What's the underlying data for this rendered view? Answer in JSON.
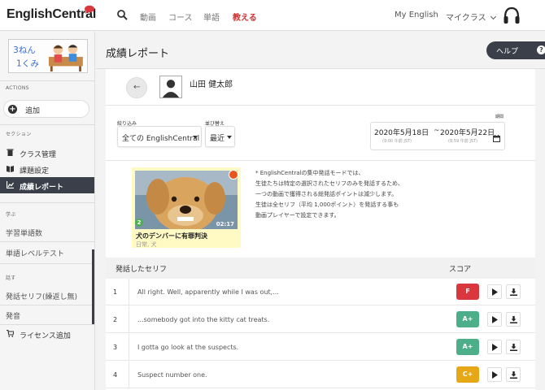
{
  "nav": {
    "logo": "EnglishCentral",
    "links": [
      "動画",
      "コース",
      "単語",
      "教える"
    ],
    "my_english": "My English",
    "my_class": "マイクラス"
  },
  "sidebar": {
    "class_image_text": "3ねん1くみ",
    "actions_label": "ACTIONS",
    "add_label": "追加",
    "section_label": "セクション",
    "items": [
      {
        "label": "クラス管理",
        "icon": "trash-icon"
      },
      {
        "label": "課題設定",
        "icon": "book-icon"
      },
      {
        "label": "成績レポート",
        "icon": "chart-icon"
      }
    ],
    "study_label": "学ぶ",
    "study_items": [
      "学習単語数",
      "単語レベルテスト"
    ],
    "speak_label": "話す",
    "speak_items": [
      "発話セリフ(繰返し無)",
      "発音"
    ],
    "license_label": "ライセンス追加"
  },
  "main": {
    "title": "成績レポート",
    "help_label": "ヘルプ",
    "user_name": "山田 健太郎",
    "filter_label": "絞り込み",
    "filter_value": "全ての EnglishCentral",
    "sort_label": "並び替え",
    "sort_value": "最近",
    "period_label": "期間",
    "date_from": "2020年5月18日",
    "date_from_time": "(9:00 午前 JST)",
    "date_sep": "~",
    "date_to": "2020年5月22日",
    "date_to_time": "(8:59 午前 JST)"
  },
  "video": {
    "title": "犬のデンバーに有罪判決",
    "subtitle": "日常, 犬",
    "badge": "2",
    "duration": "02:17"
  },
  "note": [
    "* EnglishCentralの集中発話モードでは、",
    "生徒たちは特定の選択されたセリフのみを発話するため、",
    "一つの動画で獲得される総発話ポイントは減少します。",
    "生徒は全セリフ（平均 1,000ポイント）を発話する事も",
    "動画プレイヤーで設定できます。"
  ],
  "table": {
    "col_phrase": "発話したセリフ",
    "col_score": "スコア",
    "rows": [
      {
        "num": "1",
        "phrase": "All right. Well, apparently while I was out,...",
        "grade": "F",
        "color": "#d9363e"
      },
      {
        "num": "2",
        "phrase": "...somebody got into the kitty cat treats.",
        "grade": "A+",
        "color": "#4caf8a"
      },
      {
        "num": "3",
        "phrase": "I gotta go look at the suspects.",
        "grade": "A+",
        "color": "#4caf8a"
      },
      {
        "num": "4",
        "phrase": "Suspect number one.",
        "grade": "C+",
        "color": "#e6a817"
      }
    ]
  },
  "colors": {
    "accent_dark": "#3a3f4a",
    "nav_active": "#cc3333",
    "video_card_bg": "#fff9c4"
  }
}
